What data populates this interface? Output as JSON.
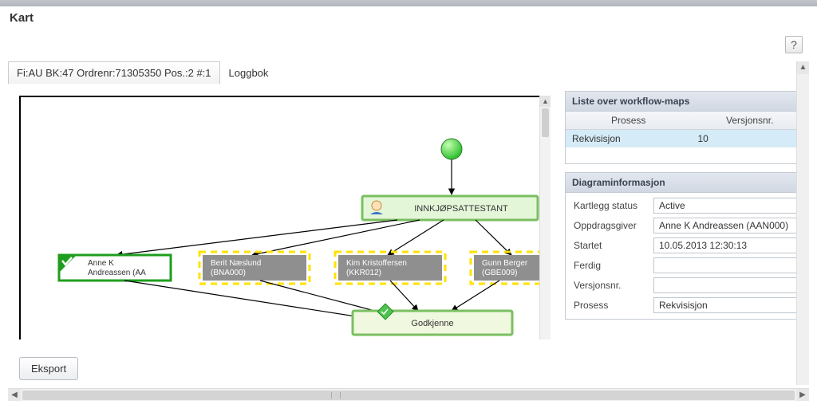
{
  "header": {
    "title": "Kart"
  },
  "help": {
    "label": "?"
  },
  "tabs": {
    "active": {
      "label": "Fi:AU BK:47 Ordrenr:71305350 Pos.:2 #:1"
    },
    "loggbok": {
      "label": "Loggbok"
    }
  },
  "diagram": {
    "role_label": "INNKJØPSATTESTANT",
    "godkjenne_label": "Godkjenne",
    "nodes": {
      "anne": {
        "line1": "Anne K",
        "line2": "Andreassen (AA"
      },
      "berit": {
        "line1": "Berit Næslund",
        "line2": "(BNA000)"
      },
      "kim": {
        "line1": "Kim Kristoffersen",
        "line2": "(KKR012)"
      },
      "gunn": {
        "line1": "Gunn Berger",
        "line2": "(GBE009)"
      }
    }
  },
  "workflow_panel": {
    "title": "Liste over workflow-maps",
    "col_process": "Prosess",
    "col_version": "Versjonsnr.",
    "row": {
      "process": "Rekvisisjon",
      "version": "10"
    }
  },
  "info_panel": {
    "title": "Diagraminformasjon",
    "fields": {
      "kartlegg_label": "Kartlegg status",
      "kartlegg_value": "Active",
      "oppdragsgiver_label": "Oppdragsgiver",
      "oppdragsgiver_value": "Anne K Andreassen (AAN000)",
      "startet_label": "Startet",
      "startet_value": "10.05.2013 12:30:13",
      "ferdig_label": "Ferdig",
      "ferdig_value": "",
      "versjon_label": "Versjonsnr.",
      "versjon_value": "",
      "prosess_label": "Prosess",
      "prosess_value": "Rekvisisjon"
    }
  },
  "export": {
    "label": "Eksport"
  }
}
